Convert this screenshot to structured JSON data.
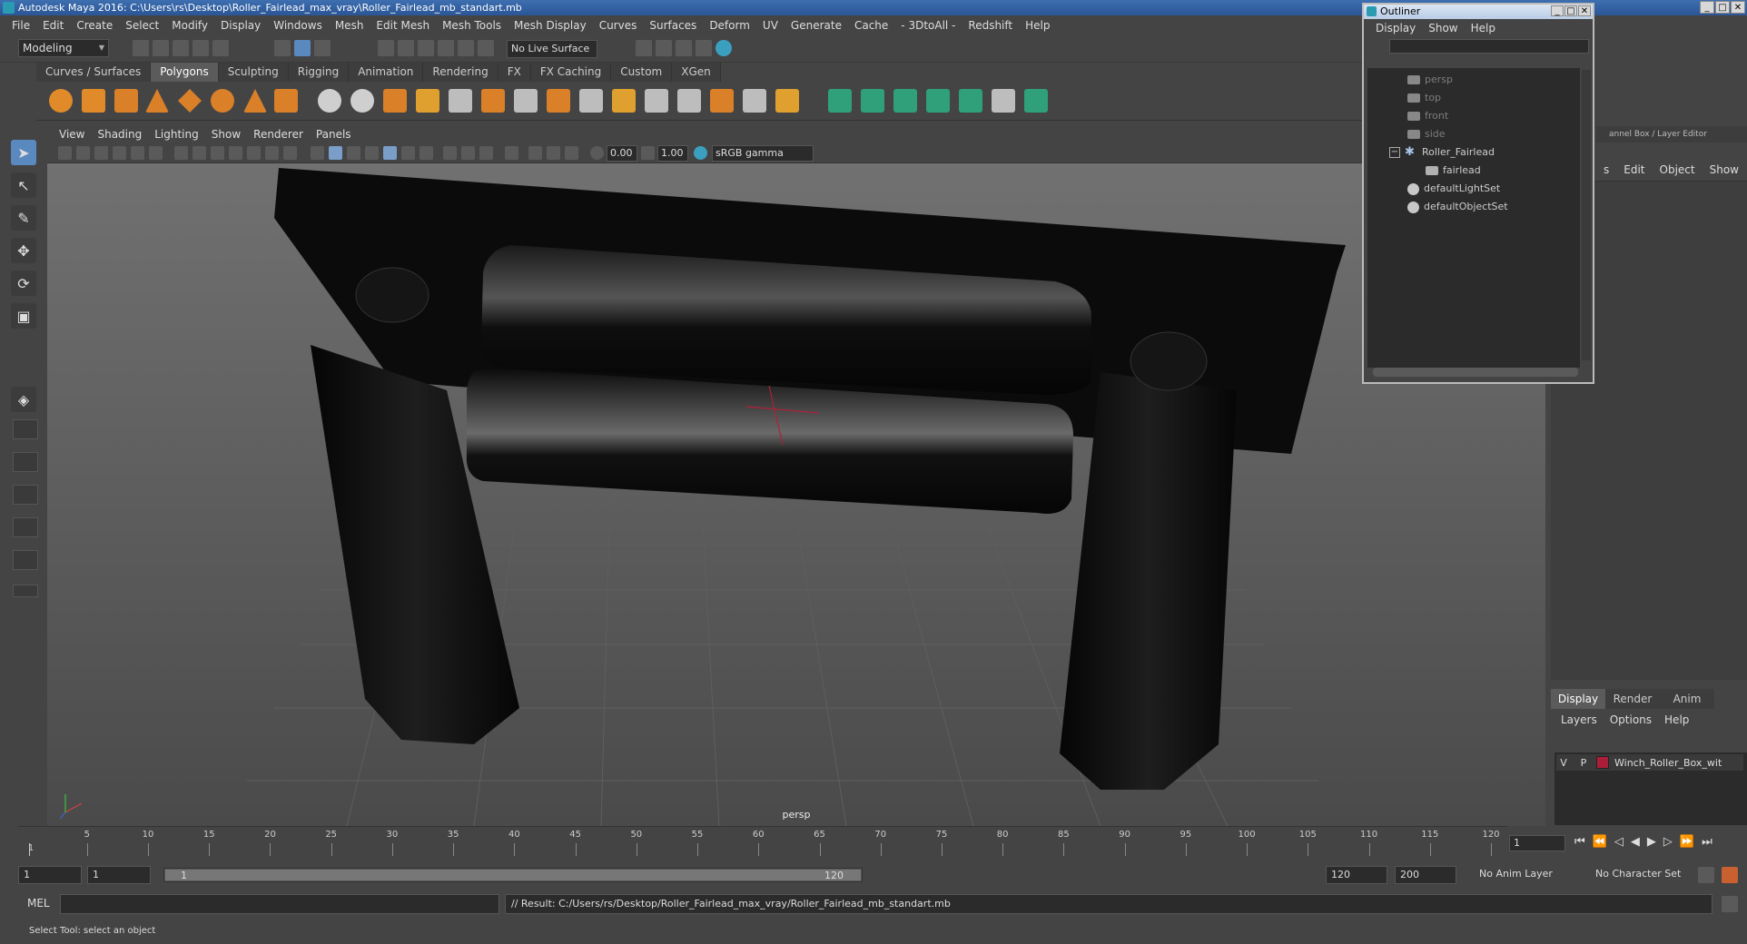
{
  "title_bar": {
    "title": "Autodesk Maya 2016: C:\\Users\\rs\\Desktop\\Roller_Fairlead_max_vray\\Roller_Fairlead_mb_standart.mb"
  },
  "menubar": [
    "File",
    "Edit",
    "Create",
    "Select",
    "Modify",
    "Display",
    "Windows",
    "Mesh",
    "Edit Mesh",
    "Mesh Tools",
    "Mesh Display",
    "Curves",
    "Surfaces",
    "Deform",
    "UV",
    "Generate",
    "Cache",
    "- 3DtoAll -",
    "Redshift",
    "Help"
  ],
  "status_line": {
    "mode": "Modeling",
    "live_surface": "No Live Surface"
  },
  "shelf": {
    "tabs": [
      "Curves / Surfaces",
      "Polygons",
      "Sculpting",
      "Rigging",
      "Animation",
      "Rendering",
      "FX",
      "FX Caching",
      "Custom",
      "XGen"
    ],
    "active_tab": "Polygons"
  },
  "viewport": {
    "menus": [
      "View",
      "Shading",
      "Lighting",
      "Show",
      "Renderer",
      "Panels"
    ],
    "exposure": "0.00",
    "gamma": "1.00",
    "color_space": "sRGB gamma",
    "camera_label": "persp"
  },
  "outliner": {
    "title": "Outliner",
    "menus": [
      "Display",
      "Show",
      "Help"
    ],
    "items": [
      {
        "label": "persp",
        "dim": true
      },
      {
        "label": "top",
        "dim": true
      },
      {
        "label": "front",
        "dim": true
      },
      {
        "label": "side",
        "dim": true
      },
      {
        "label": "Roller_Fairlead",
        "dim": false
      },
      {
        "label": "fairlead",
        "dim": false
      },
      {
        "label": "defaultLightSet",
        "dim": false
      },
      {
        "label": "defaultObjectSet",
        "dim": false
      }
    ]
  },
  "channel_box": {
    "header": "annel Box / Layer Editor",
    "menus": [
      "s",
      "Edit",
      "Object",
      "Show"
    ]
  },
  "layer_editor": {
    "tabs": [
      "Display",
      "Render",
      "Anim"
    ],
    "active_tab": "Display",
    "menus": [
      "Layers",
      "Options",
      "Help"
    ],
    "layers": [
      {
        "v": "V",
        "p": "P",
        "name": "Winch_Roller_Box_wit",
        "color": "#aa1e3a"
      }
    ]
  },
  "time_slider": {
    "ticks": [
      "5",
      "10",
      "15",
      "20",
      "25",
      "30",
      "35",
      "40",
      "45",
      "50",
      "55",
      "60",
      "65",
      "70",
      "75",
      "80",
      "85",
      "90",
      "95",
      "100",
      "105",
      "110",
      "115",
      "120"
    ],
    "start_marker": "1",
    "current_frame": "1"
  },
  "range_slider": {
    "start": "1",
    "playback_start": "1",
    "range_start_label": "1",
    "range_end_label": "120",
    "playback_end": "120",
    "end": "200",
    "anim_layer": "No Anim Layer",
    "character_set": "No Character Set"
  },
  "command_line": {
    "label": "MEL",
    "result": "// Result: C:/Users/rs/Desktop/Roller_Fairlead_max_vray/Roller_Fairlead_mb_standart.mb"
  },
  "help_line": {
    "text": "Select Tool: select an object"
  }
}
